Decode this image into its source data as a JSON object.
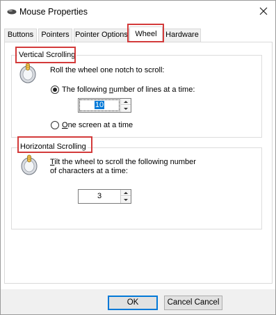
{
  "window": {
    "title": "Mouse Properties"
  },
  "tabs": [
    {
      "label": "Buttons"
    },
    {
      "label": "Pointers"
    },
    {
      "label": "Pointer Options"
    },
    {
      "label": "Wheel",
      "active": true
    },
    {
      "label": "Hardware"
    }
  ],
  "vertical": {
    "title": "Vertical Scrolling",
    "instruction": "Roll the wheel one notch to scroll:",
    "option_lines_pre": "The following ",
    "option_lines_key": "n",
    "option_lines_post": "umber of lines at a time:",
    "lines_value": "10",
    "option_screen_key": "O",
    "option_screen_post": "ne screen at a time",
    "selected_option": "lines"
  },
  "horizontal": {
    "title": "Horizontal Scrolling",
    "instruction_key": "T",
    "instruction_line1_post": "ilt the wheel to scroll the following number",
    "instruction_line2": "of characters at a time:",
    "chars_value": "3"
  },
  "footer": {
    "ok_label": "OK",
    "cancel_label": "Cancel Cancel"
  },
  "colors": {
    "highlight_box": "#d33a3a",
    "default_button_border": "#0078d7",
    "selection": "#0078d7"
  },
  "icons": {
    "title": "mouse-icon",
    "close": "close-icon",
    "vertical": "mouse-wheel-icon",
    "horizontal": "mouse-wheel-icon"
  }
}
